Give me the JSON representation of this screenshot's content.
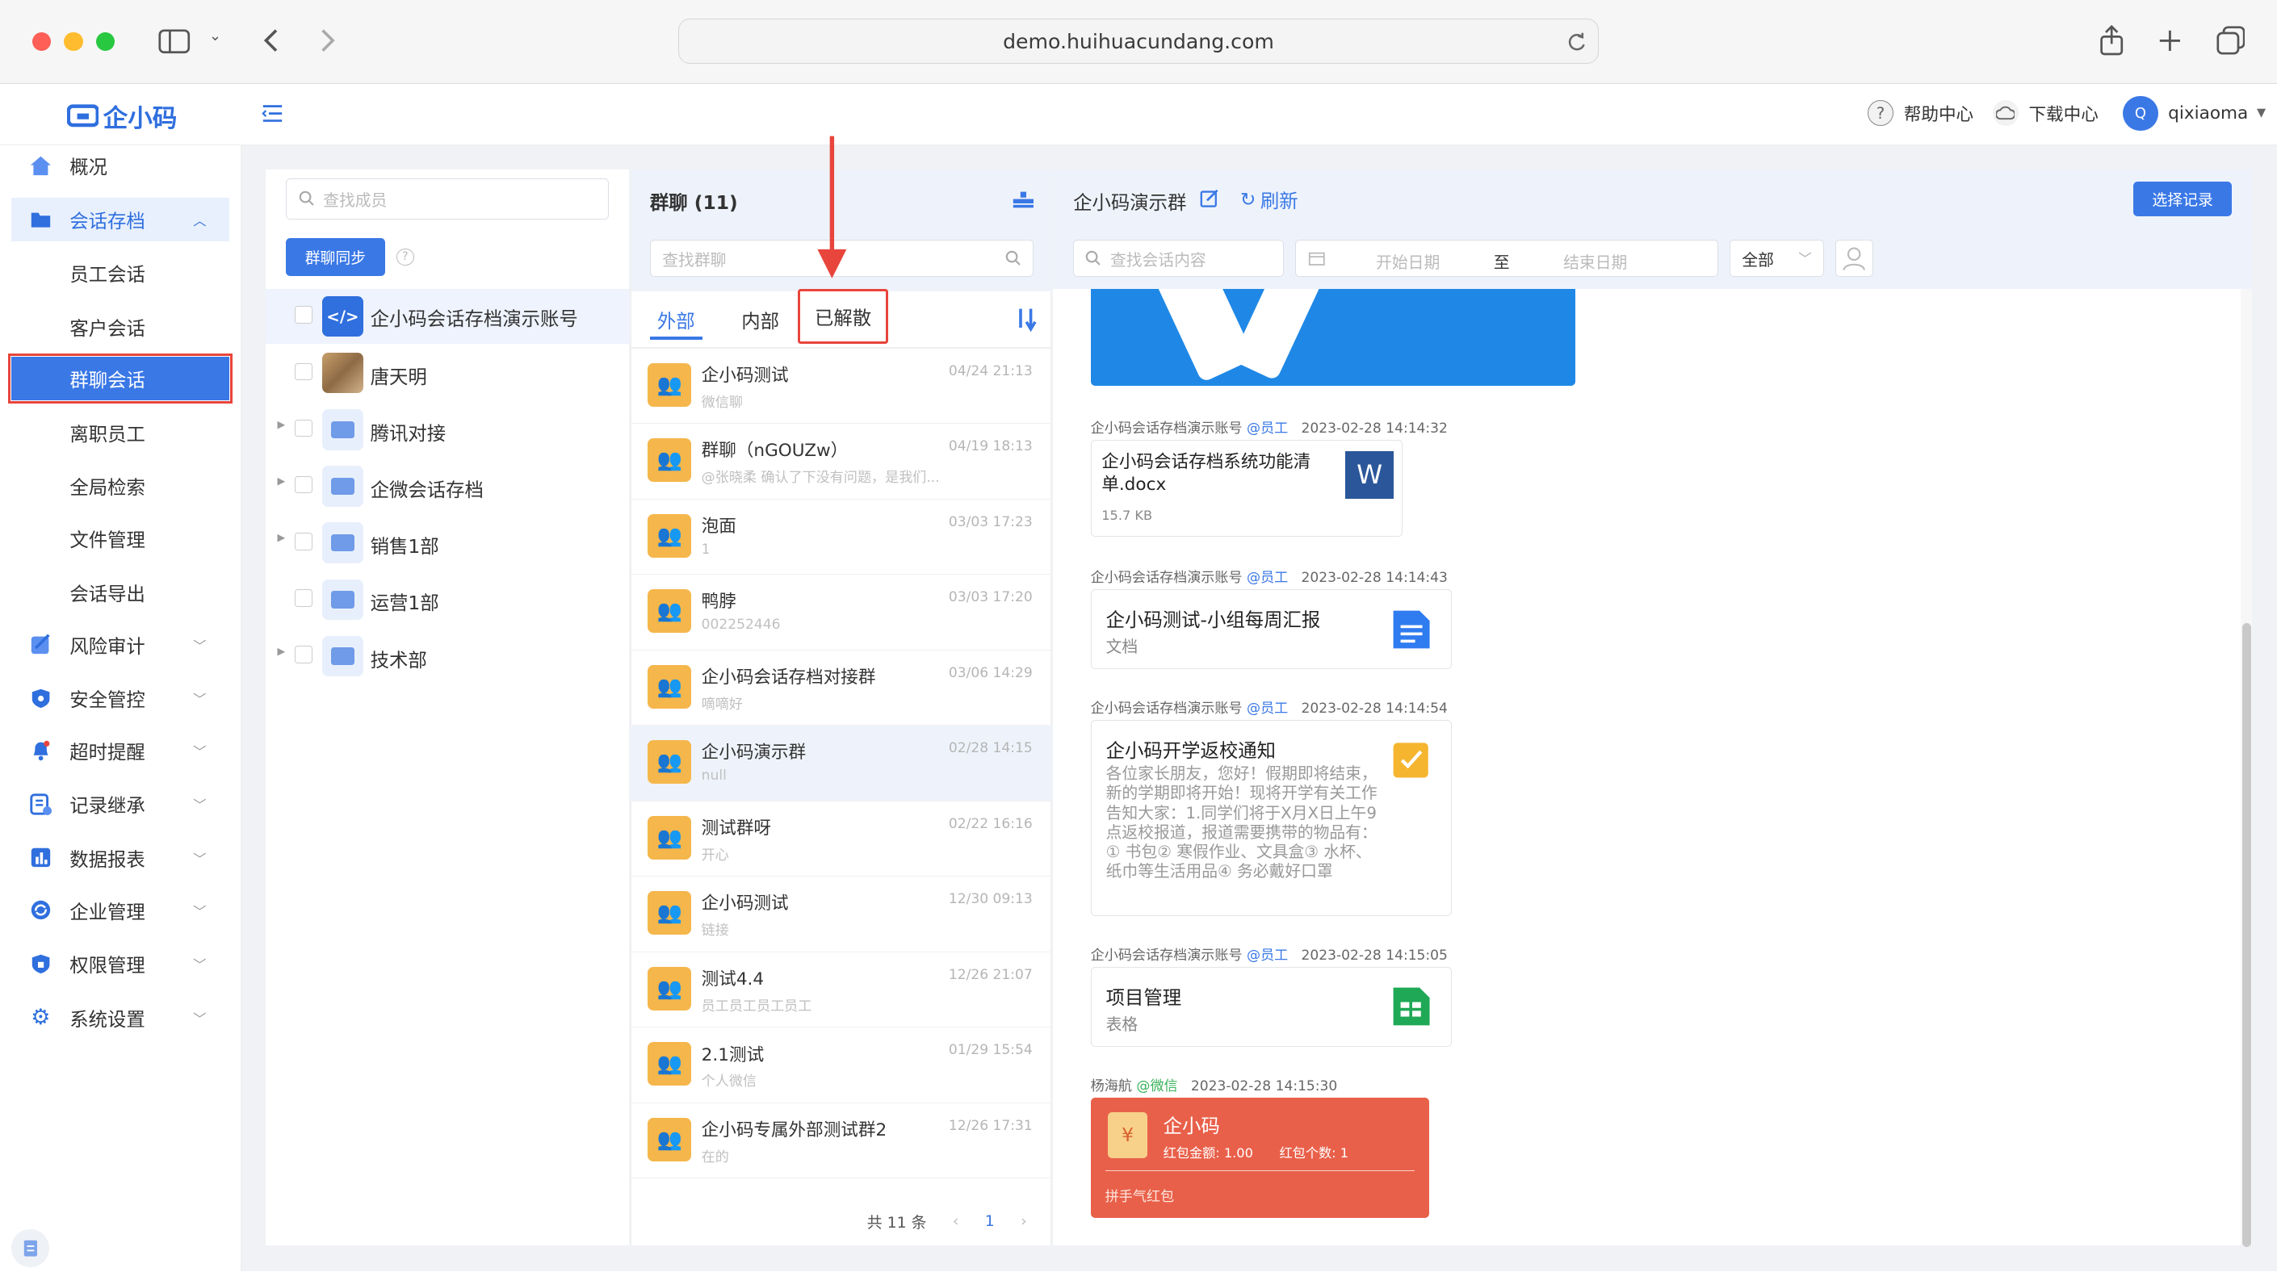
{
  "browser": {
    "url": "demo.huihuacundang.com"
  },
  "app": {
    "logo_text": "企小码",
    "header_links": [
      "帮助中心",
      "下载中心"
    ],
    "user": {
      "initial": "Q",
      "name": "qixiaoma"
    }
  },
  "sidebar": {
    "items": [
      {
        "label": "概况",
        "icon": "home-icon"
      },
      {
        "label": "会话存档",
        "icon": "folder-icon",
        "expanded": true
      },
      {
        "label": "风险审计",
        "icon": "audit-icon"
      },
      {
        "label": "安全管控",
        "icon": "shield-icon"
      },
      {
        "label": "超时提醒",
        "icon": "bell-icon"
      },
      {
        "label": "记录继承",
        "icon": "record-icon"
      },
      {
        "label": "数据报表",
        "icon": "chart-icon"
      },
      {
        "label": "企业管理",
        "icon": "sync-icon"
      },
      {
        "label": "权限管理",
        "icon": "lock-icon"
      },
      {
        "label": "系统设置",
        "icon": "gear-icon"
      }
    ],
    "subitems": [
      "员工会话",
      "客户会话",
      "群聊会话",
      "离职员工",
      "全局检索",
      "文件管理",
      "会话导出"
    ],
    "active_subitem": "群聊会话"
  },
  "members": {
    "search_placeholder": "查找成员",
    "sync_button": "群聊同步",
    "tree": [
      {
        "label": "企小码会话存档演示账号",
        "type": "account"
      },
      {
        "label": "唐天明",
        "type": "person"
      },
      {
        "label": "腾讯对接",
        "type": "folder",
        "expandable": true
      },
      {
        "label": "企微会话存档",
        "type": "folder",
        "expandable": true
      },
      {
        "label": "销售1部",
        "type": "folder",
        "expandable": true
      },
      {
        "label": "运营1部",
        "type": "folder",
        "expandable": false
      },
      {
        "label": "技术部",
        "type": "folder",
        "expandable": true
      }
    ]
  },
  "groups": {
    "title": "群聊 (11)",
    "search_placeholder": "查找群聊",
    "tabs": [
      "外部",
      "内部",
      "已解散"
    ],
    "active_tab": "外部",
    "highlighted_tab": "已解散",
    "list": [
      {
        "name": "企小码测试",
        "preview": "微信聊",
        "time": "04/24 21:13"
      },
      {
        "name": "群聊（nGOUZw）",
        "preview": "@张晓柔 确认了下没有问题，是我们...",
        "time": "04/19 18:13"
      },
      {
        "name": "泡面",
        "preview": "1",
        "time": "03/03 17:23"
      },
      {
        "name": "鸭脖",
        "preview": "002252446",
        "time": "03/03 17:20"
      },
      {
        "name": "企小码会话存档对接群",
        "preview": "嘀嘀好",
        "time": "03/06 14:29"
      },
      {
        "name": "企小码演示群",
        "preview": "null",
        "time": "02/28 14:15",
        "selected": true
      },
      {
        "name": "测试群呀",
        "preview": "开心",
        "time": "02/22 16:16"
      },
      {
        "name": "企小码测试",
        "preview": "链接",
        "time": "12/30 09:13"
      },
      {
        "name": "测试4.4",
        "preview": "员工员工员工员工",
        "time": "12/26 21:07"
      },
      {
        "name": "2.1测试",
        "preview": "个人微信",
        "time": "01/29 15:54"
      },
      {
        "name": "企小码专属外部测试群2",
        "preview": "在的",
        "time": "12/26 17:31"
      }
    ],
    "pagination": {
      "total_text": "共 11 条",
      "page": "1"
    }
  },
  "chat": {
    "title": "企小码演示群",
    "refresh_label": "刷新",
    "select_button": "选择记录",
    "search_placeholder": "查找会话内容",
    "start_date": "开始日期",
    "date_sep": "至",
    "end_date": "结束日期",
    "filter_value": "全部",
    "messages": [
      {
        "sender": "企小码会话存档演示账号",
        "tag": "@员工",
        "time": "2023-02-28 14:14:32",
        "type": "file",
        "title": "企小码会话存档系统功能清单.docx",
        "size": "15.7 KB"
      },
      {
        "sender": "企小码会话存档演示账号",
        "tag": "@员工",
        "time": "2023-02-28 14:14:43",
        "type": "doc",
        "title": "企小码测试-小组每周汇报",
        "subtitle": "文档"
      },
      {
        "sender": "企小码会话存档演示账号",
        "tag": "@员工",
        "time": "2023-02-28 14:14:54",
        "type": "note",
        "title": "企小码开学返校通知",
        "body": "各位家长朋友，您好！假期即将结束，新的学期即将开始！现将开学有关工作告知大家：1.同学们将于X月X日上午9点返校报道，报道需要携带的物品有：① 书包② 寒假作业、文具盒③ 水杯、纸巾等生活用品④ 务必戴好口罩"
      },
      {
        "sender": "企小码会话存档演示账号",
        "tag": "@员工",
        "time": "2023-02-28 14:15:05",
        "type": "sheet",
        "title": "项目管理",
        "subtitle": "表格"
      },
      {
        "sender": "杨海航",
        "tag": "@微信",
        "time": "2023-02-28 14:15:30",
        "type": "redpacket",
        "title": "企小码",
        "amount": "红包金额: 1.00",
        "count": "红包个数: 1",
        "footer": "拼手气红包"
      }
    ]
  },
  "colors": {
    "accent": "#3a78e6",
    "redpacket": "#e9604a",
    "annotation": "#e8453c"
  }
}
